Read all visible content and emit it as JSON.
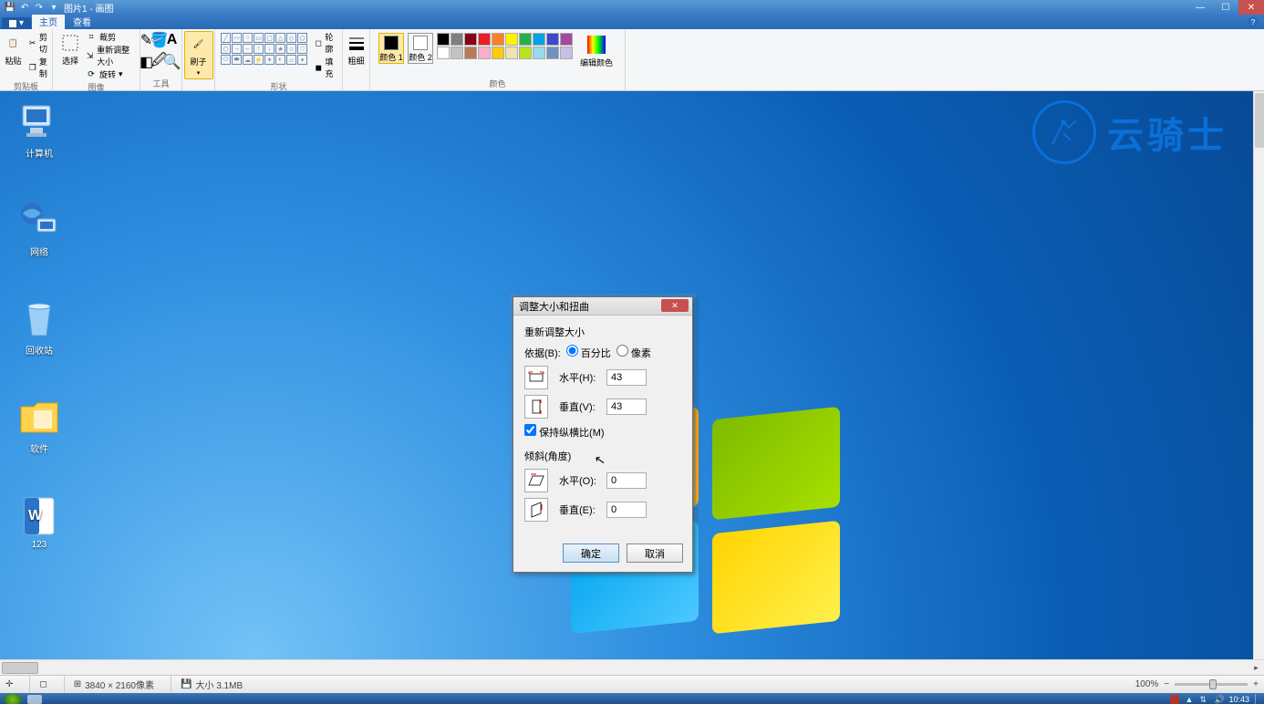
{
  "titlebar": {
    "doc_title": "图片1 - 画图"
  },
  "tabs": {
    "file": "",
    "home": "主页",
    "view": "查看"
  },
  "ribbon": {
    "clipboard": {
      "paste": "粘贴",
      "cut": "剪切",
      "copy": "复制",
      "label": "剪贴板"
    },
    "image": {
      "select": "选择",
      "crop": "裁剪",
      "resize": "重新调整大小",
      "rotate": "旋转",
      "label": "图像"
    },
    "tools": {
      "label": "工具"
    },
    "brush": {
      "label": "刷子"
    },
    "shapes": {
      "outline": "轮廓",
      "fill": "填充",
      "label": "形状"
    },
    "size": {
      "label": "粗细"
    },
    "colors": {
      "c1": "颜色 1",
      "c2": "颜色 2",
      "edit": "编辑颜色",
      "label": "颜色"
    }
  },
  "desktop": {
    "computer": "计算机",
    "network": "网络",
    "recycle": "回收站",
    "software": "软件",
    "doc123": "123"
  },
  "dialog": {
    "title": "调整大小和扭曲",
    "resize_heading": "重新调整大小",
    "by_label": "依据(B):",
    "percent": "百分比",
    "pixels": "像素",
    "horiz": "水平(H):",
    "vert": "垂直(V):",
    "h_val": "43",
    "v_val": "43",
    "aspect": "保持纵横比(M)",
    "skew_heading": "倾斜(角度)",
    "skew_h": "水平(O):",
    "skew_v": "垂直(E):",
    "skew_h_val": "0",
    "skew_v_val": "0",
    "ok": "确定",
    "cancel": "取消"
  },
  "status": {
    "dims": "3840 × 2160像素",
    "size": "大小 3.1MB",
    "zoom": "100%"
  },
  "taskbar": {
    "clock": "10:43"
  },
  "brand": "云骑士",
  "palette": {
    "row1": [
      "#000000",
      "#7f7f7f",
      "#880015",
      "#ed1c24",
      "#ff7f27",
      "#fff200",
      "#22b14c",
      "#00a2e8",
      "#3f48cc",
      "#a349a4"
    ],
    "row2": [
      "#ffffff",
      "#c3c3c3",
      "#b97a57",
      "#ffaec9",
      "#ffc90e",
      "#efe4b0",
      "#b5e61d",
      "#99d9ea",
      "#7092be",
      "#c8bfe7"
    ]
  }
}
